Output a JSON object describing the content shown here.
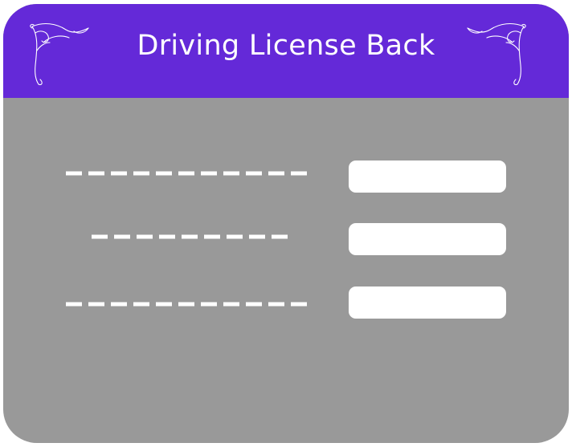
{
  "card": {
    "title": "Driving License Back",
    "header_color": "#6429D8",
    "body_color": "#999999",
    "field_color": "#FFFFFF",
    "ornament_icon": "filigree-corner-icon"
  },
  "rows": [
    {
      "dash_segments": 11
    },
    {
      "dash_segments": 9
    },
    {
      "dash_segments": 11
    }
  ]
}
